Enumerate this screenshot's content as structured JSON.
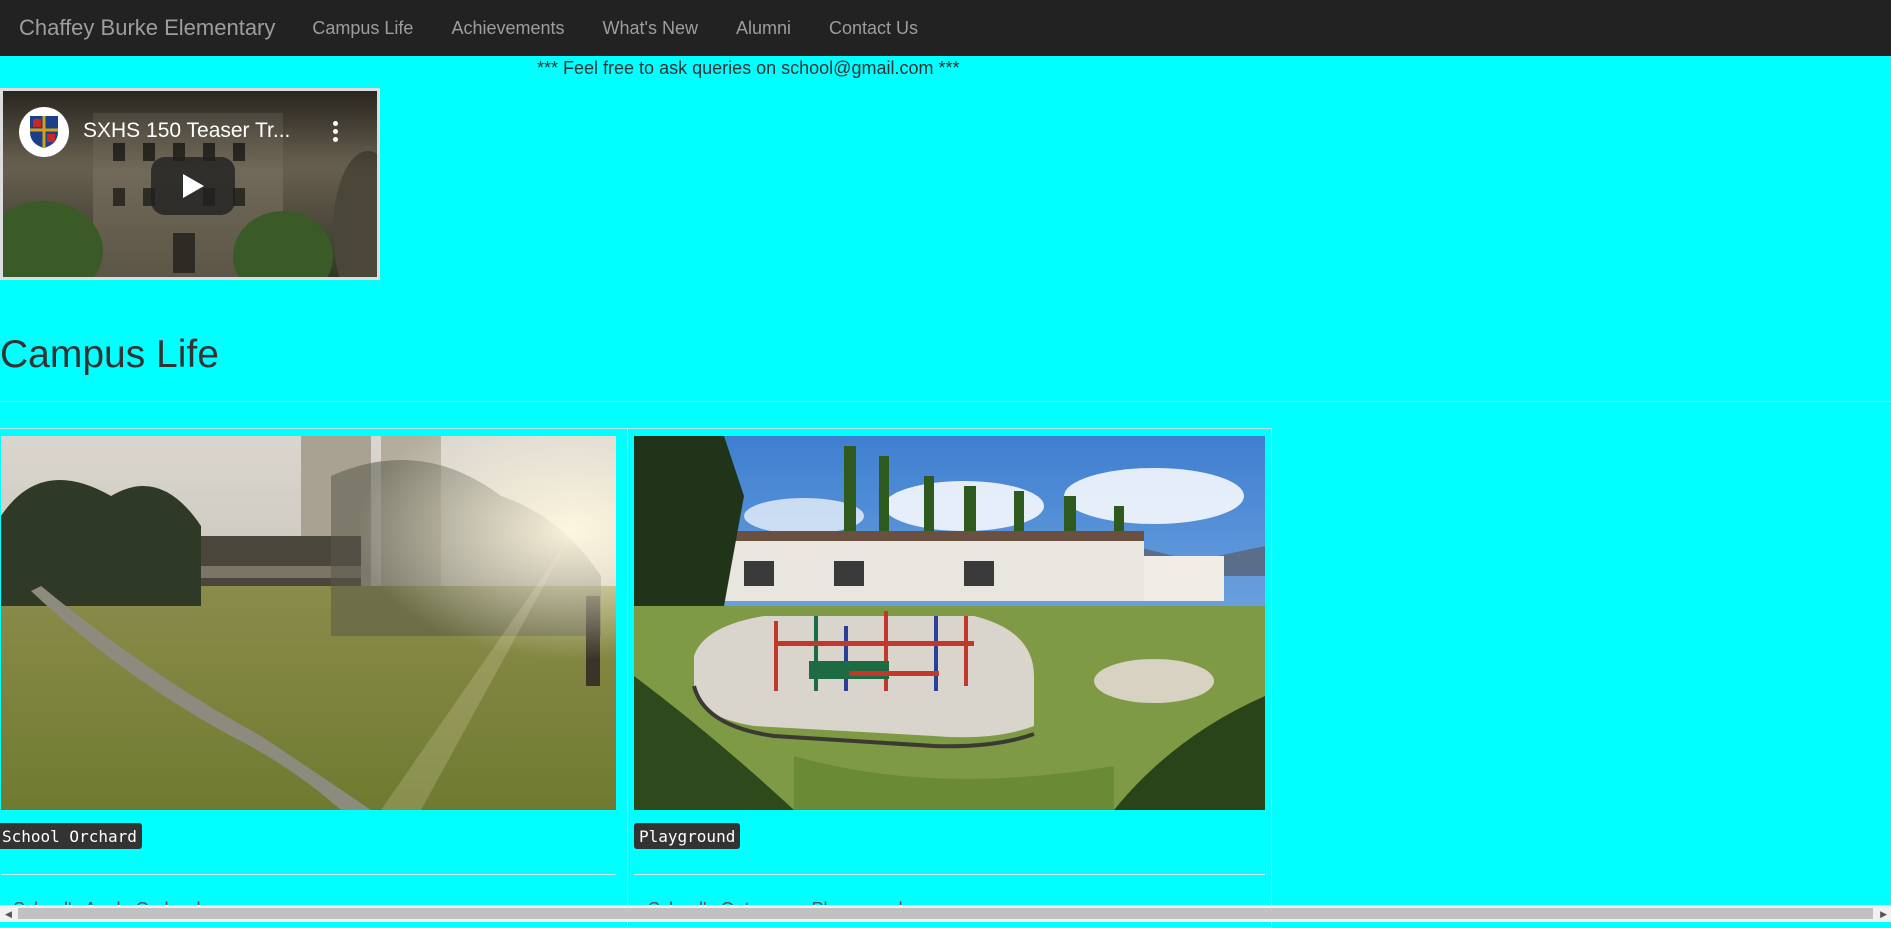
{
  "navbar": {
    "brand": "Chaffey Burke Elementary",
    "links": [
      "Campus Life",
      "Achievements",
      "What's New",
      "Alumni",
      "Contact Us"
    ]
  },
  "notice": "*** Feel free to ask queries on school@gmail.com ***",
  "video": {
    "title": "SXHS 150 Teaser Tr..."
  },
  "section": {
    "heading": "Campus Life"
  },
  "cards": [
    {
      "tag": "School Orchard",
      "text": "School's Apple Orchard"
    },
    {
      "tag": "Playground",
      "text": "School's Outer area Playground"
    }
  ],
  "colors": {
    "background": "#00ffff",
    "navbar": "#222222",
    "nav_text": "#9d9d9d"
  }
}
